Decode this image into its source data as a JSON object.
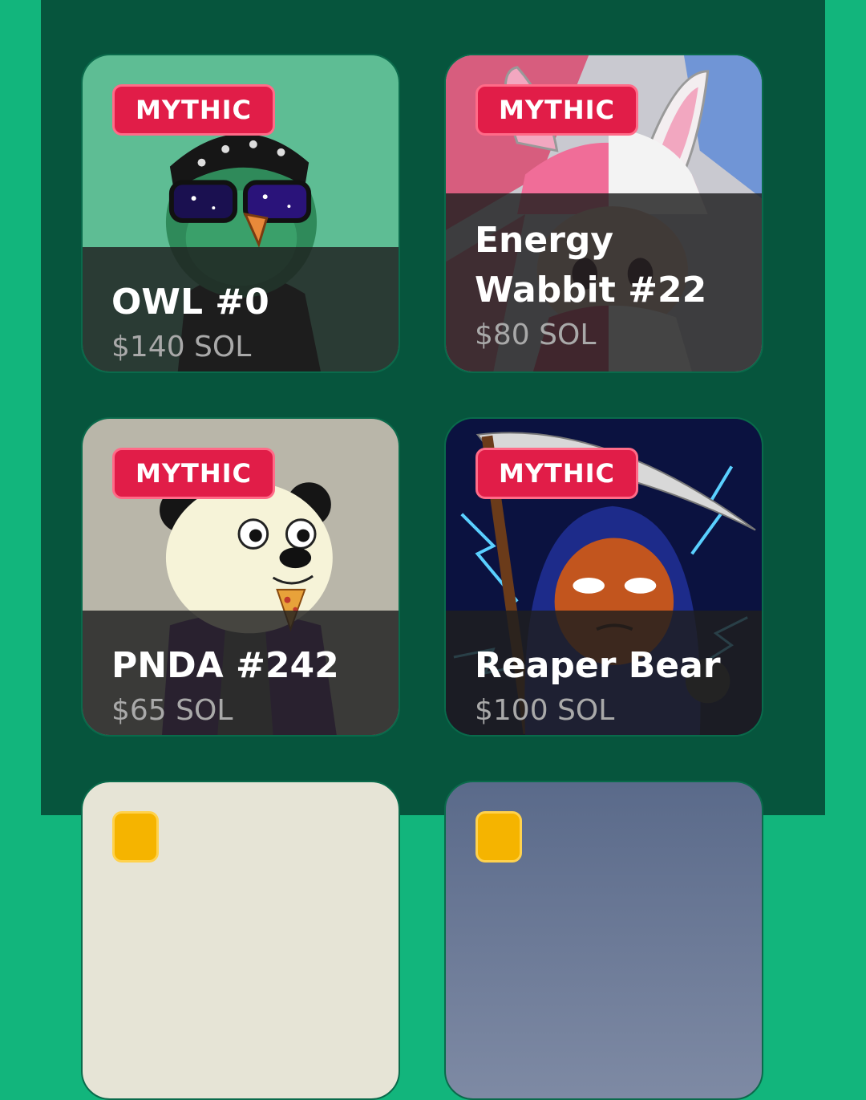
{
  "cards": [
    {
      "name": "OWL #0",
      "price": "$140 SOL",
      "badge": "MYTHIC",
      "bg": "#5ebd94"
    },
    {
      "name": "Energy Wabbit #22",
      "price": "$80 SOL",
      "badge": "MYTHIC",
      "bg": "#d94a70"
    },
    {
      "name": "PNDA #242",
      "price": "$65 SOL",
      "badge": "MYTHIC",
      "bg": "#b9b6a9"
    },
    {
      "name": "Reaper Bear",
      "price": "$100 SOL",
      "badge": "MYTHIC",
      "bg": "#0b1240"
    }
  ],
  "colors": {
    "outer_bg": "#12b57c",
    "panel_bg": "#06553d",
    "badge_bg": "#e11d48",
    "partial_badge_bg": "#f5b400"
  }
}
